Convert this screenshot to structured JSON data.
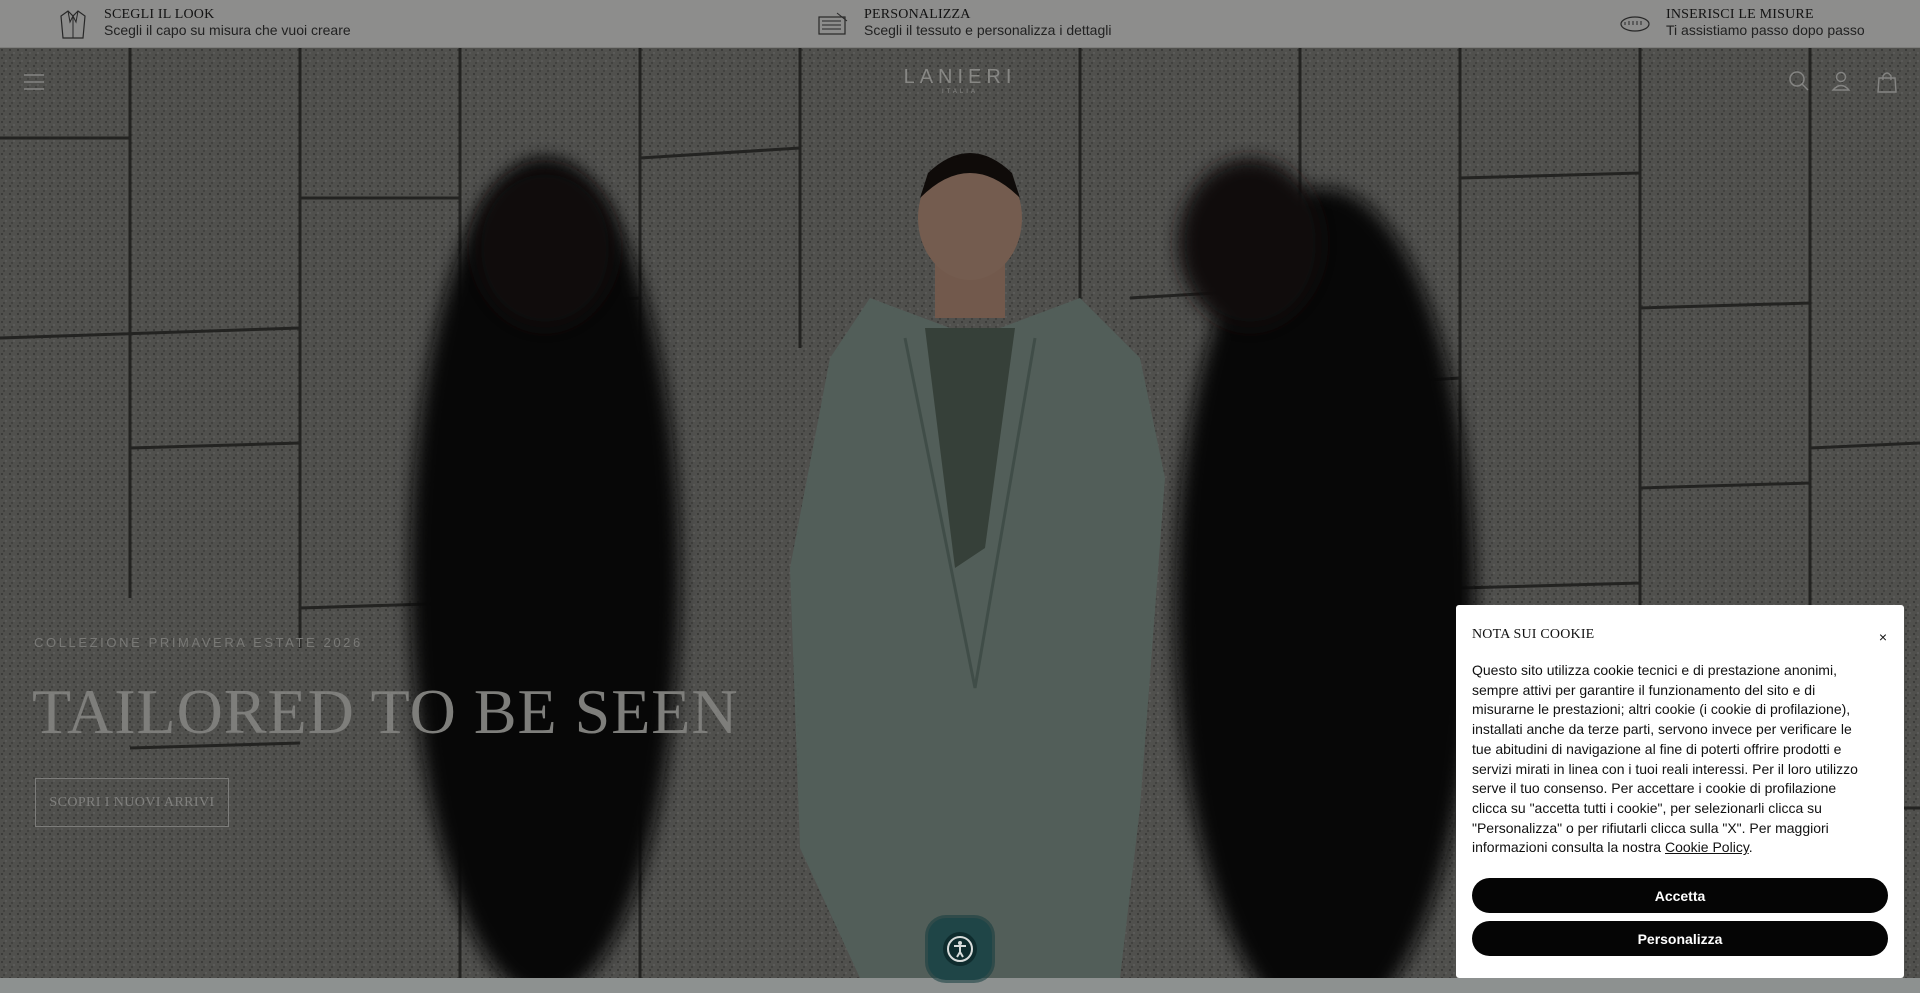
{
  "usp": [
    {
      "icon": "jacket-icon",
      "title": "SCEGLI IL LOOK",
      "subtitle": "Scegli il capo su misura che vuoi creare"
    },
    {
      "icon": "fabric-swatch-icon",
      "title": "PERSONALIZZA",
      "subtitle": "Scegli il tessuto e personalizza i dettagli"
    },
    {
      "icon": "measuring-tape-icon",
      "title": "INSERISCI LE MISURE",
      "subtitle": "Ti assistiamo passo dopo passo"
    }
  ],
  "header": {
    "logo_main": "LANIERI",
    "logo_sub": "ITALIA",
    "icons": [
      "menu-icon",
      "search-icon",
      "account-icon",
      "shopping-bag-icon"
    ]
  },
  "hero": {
    "eyebrow": "COLLEZIONE PRIMAVERA ESTATE 2026",
    "title": "TAILORED TO BE SEEN",
    "cta": "SCOPRI I NUOVI ARRIVI"
  },
  "cookie": {
    "title": "NOTA SUI COOKIE",
    "close": "×",
    "body": "Questo sito utilizza cookie tecnici e di prestazione anonimi, sempre attivi per garantire il funzionamento del sito e di misurarne le prestazioni; altri cookie (i cookie di profilazione), installati anche da terze parti, servono invece per verificare le tue abitudini di navigazione al fine di poterti offrire prodotti e servizi mirati in linea con i tuoi reali interessi. Per il loro utilizzo serve il tuo consenso. Per accettare i cookie di profilazione clicca su \"accetta tutti i cookie\", per selezionarli clicca su \"Personalizza\" o per rifiutarli clicca sulla \"X\". Per maggiori informazioni consulta la nostra ",
    "link": "Cookie Policy",
    "after_link": ".",
    "accept": "Accetta",
    "customize": "Personalizza"
  },
  "accessibility": {
    "icon": "accessibility-icon"
  },
  "colors": {
    "overlay": "#000000",
    "button": "#050505",
    "usp_bg": "#f3f3f1",
    "a11y": "#1f4547"
  }
}
